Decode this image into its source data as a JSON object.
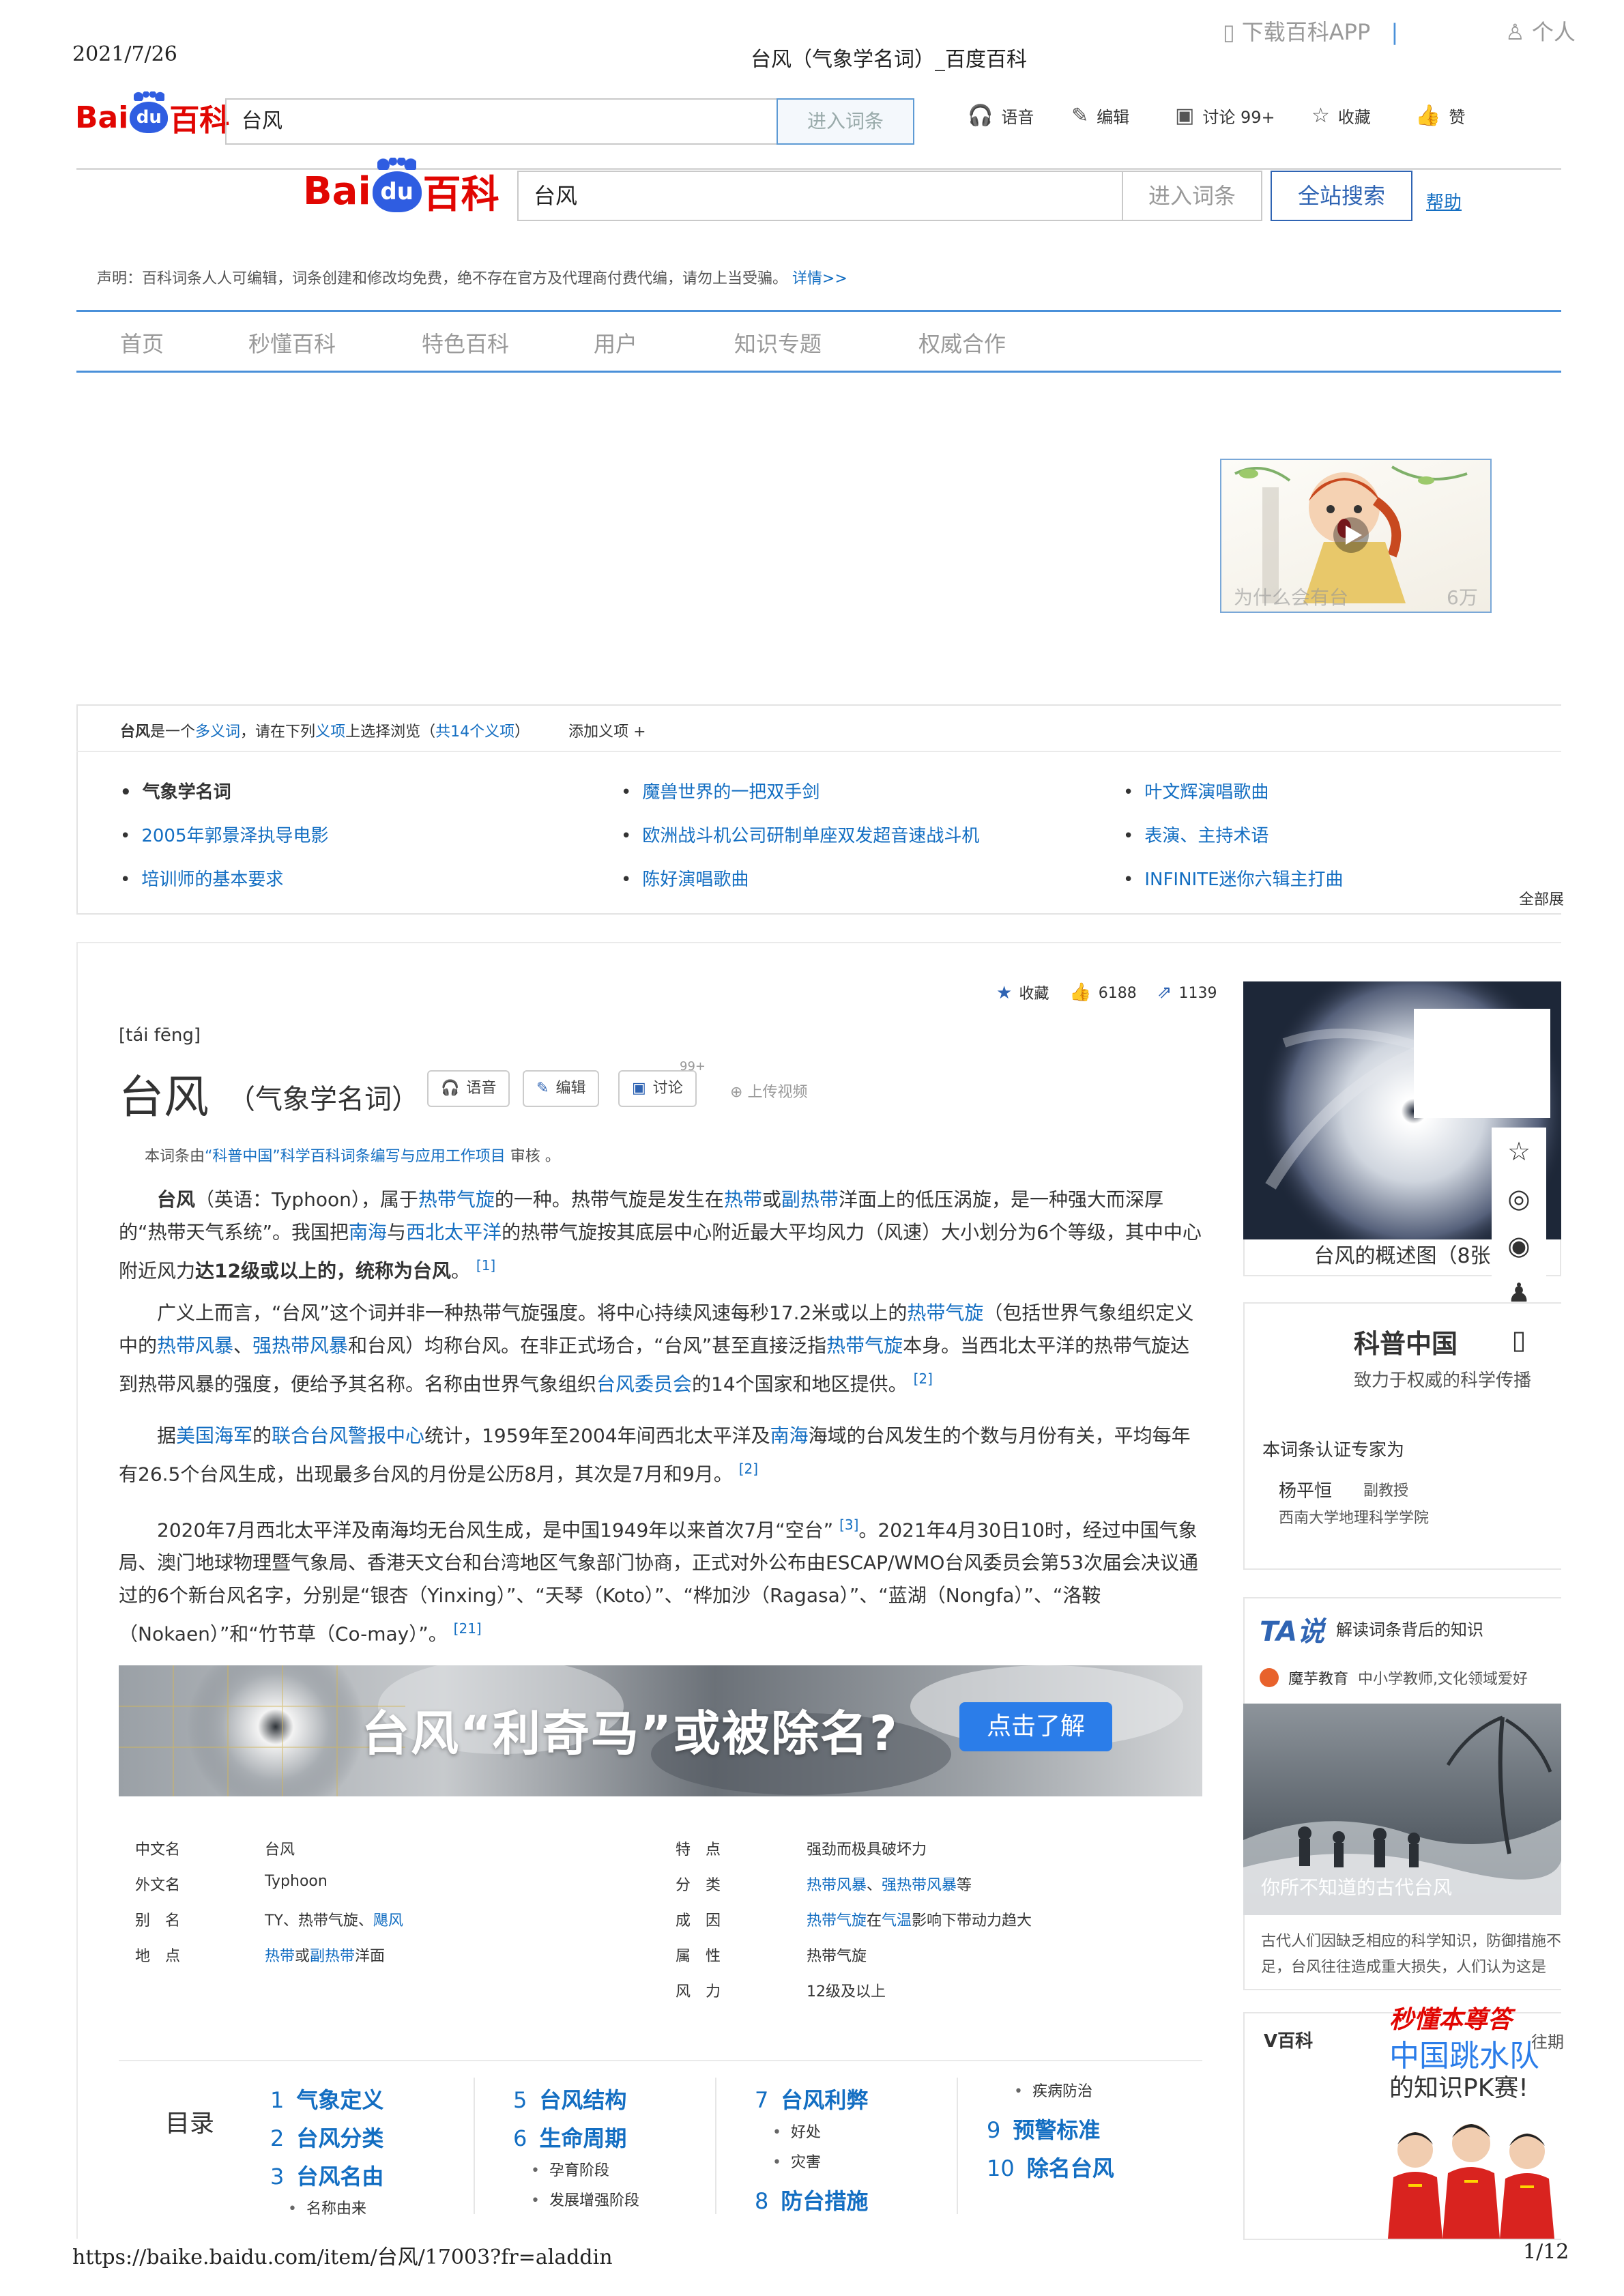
{
  "print": {
    "date": "2021/7/26",
    "title": "台风（气象学名词）_百度百科",
    "url": "https://baike.baidu.com/item/台风/17003?fr=aladdin",
    "page": "1/12"
  },
  "logo": {
    "bai": "Bai",
    "du": "du",
    "baike": "百科"
  },
  "topbar": {
    "search_value": "台风",
    "enter_label": "进入词条",
    "tools": [
      {
        "icon": "headphones-icon",
        "label": "语音"
      },
      {
        "icon": "edit-icon",
        "label": "编辑"
      },
      {
        "icon": "discuss-icon",
        "label": "讨论 99+"
      },
      {
        "icon": "star-icon",
        "label": "收藏"
      },
      {
        "icon": "thumbs-up-icon",
        "label": "赞"
      }
    ]
  },
  "header": {
    "search_value": "台风",
    "enter_label": "进入词条",
    "search_all_label": "全站搜索",
    "help_label": "帮助"
  },
  "notice": {
    "text": "声明：百科词条人人可编辑，词条创建和修改均免费，绝不存在官方及代理商付费代编，请勿上当受骗。",
    "link": "详情>>"
  },
  "nav": {
    "items": [
      "首页",
      "秒懂百科",
      "特色百科",
      "用户",
      "知识专题",
      "权威合作"
    ],
    "app_label": "下载百科APP",
    "user_label": "个人"
  },
  "ad": {
    "overlay_left": "为什么会有台",
    "overlay_right": "6万"
  },
  "polysemy": {
    "head_term": "台风",
    "head_text_1": "是一个",
    "head_link_1": "多义词",
    "head_text_2": "，请在下列",
    "head_link_2": "义项",
    "head_text_3": "上选择浏览（",
    "head_link_3": "共14个义项",
    "head_text_4": "）",
    "add_label": "添加义项 +",
    "items": [
      "气象学名词",
      "魔兽世界的一把双手剑",
      "叶文辉演唱歌曲",
      "2005年郭景泽执导电影",
      "欧洲战斗机公司研制单座双发超音速战斗机",
      "表演、主持术语",
      "培训师的基本要求",
      "陈好演唱歌曲",
      "INFINITE迷你六辑主打曲"
    ],
    "all_label": "全部展"
  },
  "article": {
    "pinyin": "[tái fēng]",
    "title": "台风",
    "subtitle": "（气象学名词）",
    "buttons": {
      "voice": "语音",
      "edit": "编辑",
      "discuss": "讨论",
      "discuss_count": "99+",
      "upload": "上传视频"
    },
    "stats": {
      "fav_label": "收藏",
      "likes": "6188",
      "shares": "1139"
    },
    "reviewed_pre": "本词条由",
    "reviewed_link": "“科普中国”科学百科词条编写与应用工作项目",
    "reviewed_post": " 审核 。",
    "p1": {
      "a": "台风",
      "b": "（英语：Typhoon），属于",
      "c": "热带气旋",
      "d": "的一种。热带气旋是发生在",
      "e": "热带",
      "f": "或",
      "g": "副热带",
      "h": "洋面上的低压涡旋，是一种强大而深厚的“热带天气系统”。我国把",
      "i": "南海",
      "j": "与",
      "k": "西北太平洋",
      "l": "的热带气旋按其底层中心附近最大平均风力（风速）大小划分为6个等级，其中中心附近风力",
      "m": "达12级或以上的，统称为台风",
      "n": "。",
      "ref": "[1]"
    },
    "p2": {
      "a": "广义上而言，“台风”这个词并非一种热带气旋强度。将中心持续风速每秒17.2米或以上的",
      "b": "热带气旋",
      "c": "（包括世界气象组织定义中的",
      "d": "热带风暴",
      "e": "、",
      "f": "强热带风暴",
      "g": "和台风）均称台风。在非正式场合，“台风”甚至直接泛指",
      "h": "热带气旋",
      "i": "本身。当西北太平洋的热带气旋达到热带风暴的强度，便给予其名称。名称由世界气象组织",
      "j": "台风委员会",
      "k": "的14个国家和地区提供。",
      "ref": "[2]"
    },
    "p3": {
      "a": "据",
      "b": "美国海军",
      "c": "的",
      "d": "联合台风警报中心",
      "e": "统计，1959年至2004年间西北太平洋及",
      "f": "南海",
      "g": "海域的台风发生的个数与月份有关，平均每年有26.5个台风生成，出现最多台风的月份是公历8月，其次是7月和9月。",
      "ref": "[2]"
    },
    "p4": {
      "a": "2020年7月西北太平洋及南海均无台风生成，是中国1949年以来首次7月“空台”",
      "ref1": "[3]",
      "b": "。2021年4月30日10时，经过中国气象局、澳门地球物理暨气象局、香港天文台和台湾地区气象部门协商，正式对外公布由ESCAP/WMO台风委员会第53次届会决议通过的6个新台风名字，分别是“银杏（Yinxing）”、“天琴（Koto）”、“桦加沙（Ragasa）”、“蓝湖（Nongfa）”、“洛鞍（Nokaen）”和“竹节草（Co-may）”。",
      "ref2": "[21]"
    },
    "banner": {
      "text": "台风“利奇马”或被除名?",
      "button": "点击了解"
    }
  },
  "infobox": {
    "left": [
      {
        "k": "中文名",
        "v": "台风"
      },
      {
        "k": "外文名",
        "v": "Typhoon"
      },
      {
        "k": "别　名",
        "v1": "TY、热带气旋、",
        "v2": "飓风"
      },
      {
        "k": "地　点",
        "v1": "热带",
        "v2": "或",
        "v3": "副热带",
        "v4": "洋面"
      }
    ],
    "right": [
      {
        "k": "特　点",
        "v": "强劲而极具破坏力"
      },
      {
        "k": "分　类",
        "v1": "热带风暴",
        "v2": "、",
        "v3": "强热带风暴",
        "v4": "等"
      },
      {
        "k": "成　因",
        "v1": "热带气旋",
        "v2": "在",
        "v3": "气温",
        "v4": "影响下带动力趋大"
      },
      {
        "k": "属　性",
        "v": "热带气旋"
      },
      {
        "k": "风　力",
        "v": "12级及以上"
      }
    ]
  },
  "toc": {
    "title": "目录",
    "items": [
      {
        "n": "1",
        "label": "气象定义"
      },
      {
        "n": "2",
        "label": "台风分类"
      },
      {
        "n": "3",
        "label": "台风名由"
      },
      {
        "n": "5",
        "label": "台风结构"
      },
      {
        "n": "6",
        "label": "生命周期"
      },
      {
        "n": "7",
        "label": "台风利弊"
      },
      {
        "n": "8",
        "label": "防台措施"
      },
      {
        "n": "9",
        "label": "预警标准"
      },
      {
        "n": "10",
        "label": "除名台风"
      }
    ],
    "subs": [
      "名称由来",
      "孕育阶段",
      "发展增强阶段",
      "好处",
      "灾害",
      "疾病防治"
    ]
  },
  "side": {
    "img_caption": "台风的概述图（8张",
    "kp_title": "科普中国",
    "kp_sub": "致力于权威的科学传播",
    "kp_expert": "本词条认证专家为",
    "kp_name": "杨平恒",
    "kp_rank": "副教授",
    "kp_org": "西南大学地理科学学院",
    "ta_logo": "TA说",
    "ta_slogan": "解读词条背后的知识",
    "ta_author": "魔芋教育",
    "ta_author_desc": "中小学教师,文化领域爱好",
    "ta_img_caption": "你所不知道的古代台风",
    "ta_desc": "古代人们因缺乏相应的科学知识，防御措施不足，台风往往造成重大损失，人们认为这是",
    "v_title": "V百科",
    "v_brand": "秒懂本尊答",
    "v_sub1": "中国跳水队",
    "v_sub2": "的知识PK赛!",
    "v_period": "往期"
  },
  "colors": {
    "link": "#136ec2",
    "brand_red": "#e10602",
    "brand_blue": "#2f5de1"
  }
}
